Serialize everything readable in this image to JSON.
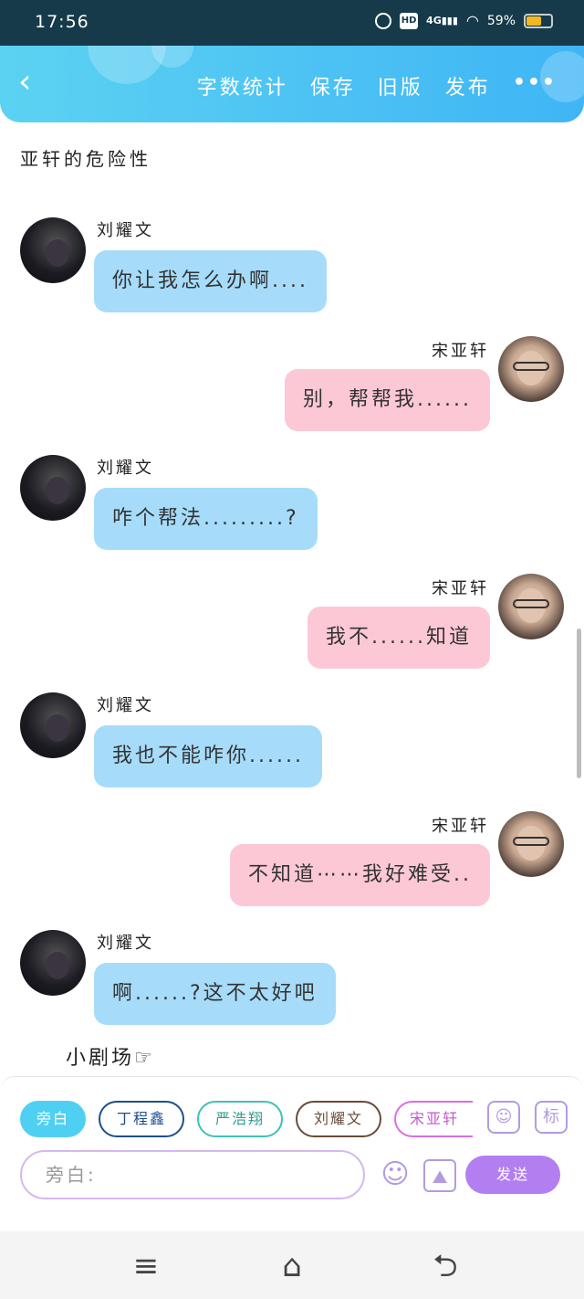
{
  "status_bar": {
    "time": "17:56",
    "icons": [
      "alarm-icon",
      "hd-icon",
      "signal-4g-icon",
      "wifi-icon",
      "battery-icon"
    ],
    "hd_label": "HD",
    "network_label": "4G",
    "battery_text": "59%",
    "battery_level": 0.59,
    "battery_color": "#f3b81f"
  },
  "header": {
    "back_icon": "back-arrow-icon",
    "actions": [
      "字数统计",
      "保存",
      "旧版",
      "发布"
    ],
    "more_icon": "more-dots-icon",
    "more_text": "•••",
    "gradient": [
      "#5cd2f2",
      "#3fb5f5"
    ]
  },
  "document": {
    "title": "亚轩的危险性"
  },
  "messages": [
    {
      "side": "left",
      "speaker": "刘耀文",
      "text": "你让我怎么办啊....",
      "bubble_color": "#a6dcf9"
    },
    {
      "side": "right",
      "speaker": "宋亚轩",
      "text": "别，帮帮我......",
      "bubble_color": "#fcc8d6"
    },
    {
      "side": "left",
      "speaker": "刘耀文",
      "text": "咋个帮法.........?",
      "bubble_color": "#a6dcf9"
    },
    {
      "side": "right",
      "speaker": "宋亚轩",
      "text": "我不......知道",
      "bubble_color": "#fcc8d6"
    },
    {
      "side": "left",
      "speaker": "刘耀文",
      "text": "我也不能咋你......",
      "bubble_color": "#a6dcf9"
    },
    {
      "side": "right",
      "speaker": "宋亚轩",
      "text": "不知道⋯⋯我好难受..",
      "bubble_color": "#fcc8d6"
    },
    {
      "side": "left",
      "speaker": "刘耀文",
      "text": "啊......?这不太好吧",
      "bubble_color": "#a6dcf9"
    }
  ],
  "theater_text": "小剧场☞",
  "composer": {
    "roles": [
      {
        "label": "旁白",
        "active": true,
        "color": "#4fd0f2"
      },
      {
        "label": "丁程鑫",
        "active": false,
        "color": "#1d4f8c"
      },
      {
        "label": "严浩翔",
        "active": false,
        "color": "#3fc1b5"
      },
      {
        "label": "刘耀文",
        "active": false,
        "color": "#6b4a3a"
      },
      {
        "label": "宋亚轩",
        "active": false,
        "color": "#d86fe0"
      }
    ],
    "role_manage_icon": "contact-card-icon",
    "tag_button_label": "标",
    "input_placeholder": "旁白:",
    "emoji_icon": "smile-icon",
    "image_icon": "image-icon",
    "send_label": "发送",
    "accent": "#b37ff0"
  },
  "nav_bar": {
    "icons": [
      "menu-icon",
      "home-icon",
      "back-icon"
    ],
    "glyphs": [
      "≡",
      "⌂",
      "⮌"
    ]
  }
}
